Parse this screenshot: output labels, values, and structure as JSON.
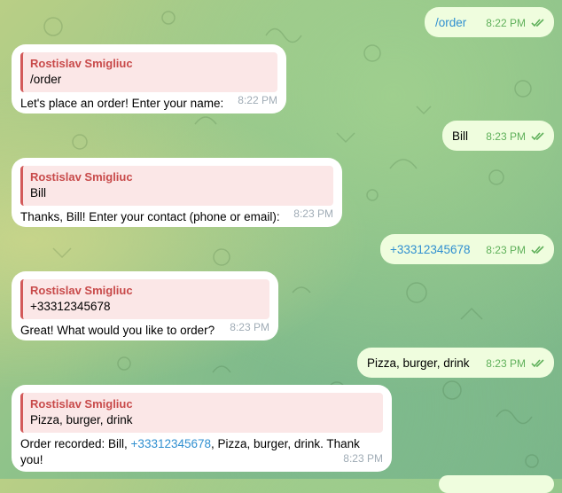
{
  "colors": {
    "incoming_bubble": "#ffffff",
    "outgoing_bubble": "#effdde",
    "quote_accent": "#d35a5a",
    "link": "#2f8fd0",
    "read_check": "#5fb05a"
  },
  "messages": [
    {
      "dir": "out",
      "text": "/order",
      "time": "8:22 PM",
      "status": "read-double-check-icon",
      "is_link": true
    },
    {
      "dir": "in",
      "reply_name": "Rostislav Smigliuc",
      "reply_text": "/order",
      "text": "Let's place an order! Enter your name:",
      "time": "8:22 PM"
    },
    {
      "dir": "out",
      "text": "Bill",
      "time": "8:23 PM",
      "status": "read-double-check-icon"
    },
    {
      "dir": "in",
      "reply_name": "Rostislav Smigliuc",
      "reply_text": "Bill",
      "text": "Thanks, Bill! Enter your contact (phone or email):",
      "time": "8:23 PM"
    },
    {
      "dir": "out",
      "text": "+33312345678",
      "time": "8:23 PM",
      "status": "read-double-check-icon",
      "is_link": true
    },
    {
      "dir": "in",
      "reply_name": "Rostislav Smigliuc",
      "reply_text": "+33312345678",
      "text": "Great! What would you like to order?",
      "time": "8:23 PM"
    },
    {
      "dir": "out",
      "text": "Pizza, burger, drink",
      "time": "8:23 PM",
      "status": "read-double-check-icon"
    },
    {
      "dir": "in",
      "reply_name": "Rostislav Smigliuc",
      "reply_text": "Pizza, burger, drink",
      "text_before": "Order recorded: Bill, ",
      "text_link": "+33312345678",
      "text_after": ", Pizza, burger, drink. Thank you!",
      "time": "8:23 PM"
    }
  ]
}
